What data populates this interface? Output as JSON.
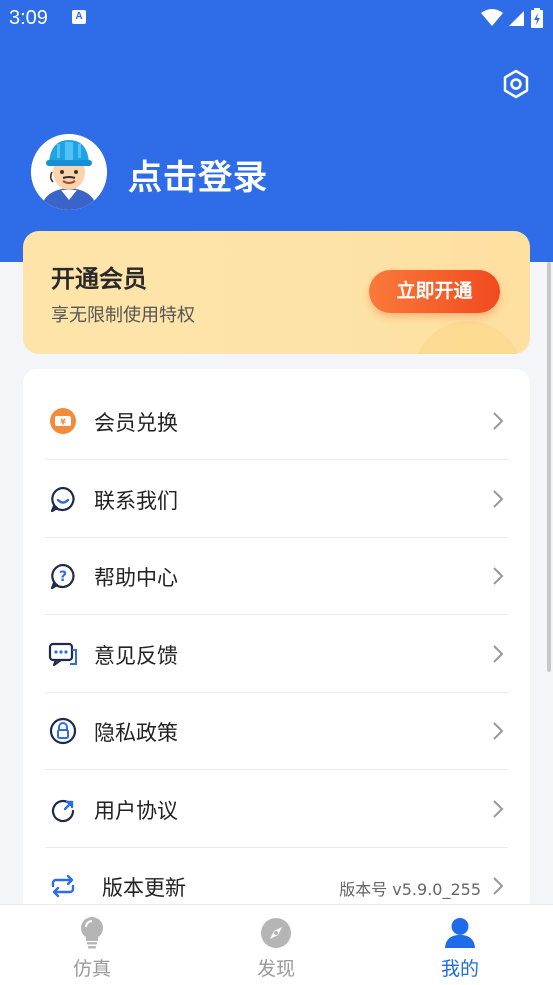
{
  "status_bar": {
    "time": "3:09",
    "notification_icon": "a-letter-icon",
    "wifi_icon": "wifi-icon",
    "signal_icon": "signal-icon",
    "battery_icon": "battery-charging-icon"
  },
  "header": {
    "settings_icon": "hexagon-settings-icon",
    "avatar_icon": "worker-helmet-avatar",
    "login_label": "点击登录"
  },
  "vip": {
    "title": "开通会员",
    "subtitle": "享无限制使用特权",
    "button_label": "立即开通"
  },
  "menu": {
    "items": [
      {
        "label": "会员兑换",
        "icon": "coupon-icon"
      },
      {
        "label": "联系我们",
        "icon": "chat-smile-icon"
      },
      {
        "label": "帮助中心",
        "icon": "help-question-icon"
      },
      {
        "label": "意见反馈",
        "icon": "feedback-bubble-icon"
      },
      {
        "label": "隐私政策",
        "icon": "privacy-lock-icon"
      },
      {
        "label": "用户协议",
        "icon": "agreement-arrow-icon"
      },
      {
        "label": "版本更新",
        "icon": "refresh-icon",
        "value": "版本号 v5.9.0_255"
      }
    ]
  },
  "bottom_nav": {
    "tabs": [
      {
        "label": "仿真",
        "icon": "lightbulb-icon",
        "active": false
      },
      {
        "label": "发现",
        "icon": "compass-icon",
        "active": false
      },
      {
        "label": "我的",
        "icon": "person-icon",
        "active": true
      }
    ]
  },
  "colors": {
    "brand_blue": "#2f6de8",
    "vip_orange": "#f04a1f",
    "active_tab": "#1f6bea",
    "inactive_tab": "#9a9a9a"
  }
}
